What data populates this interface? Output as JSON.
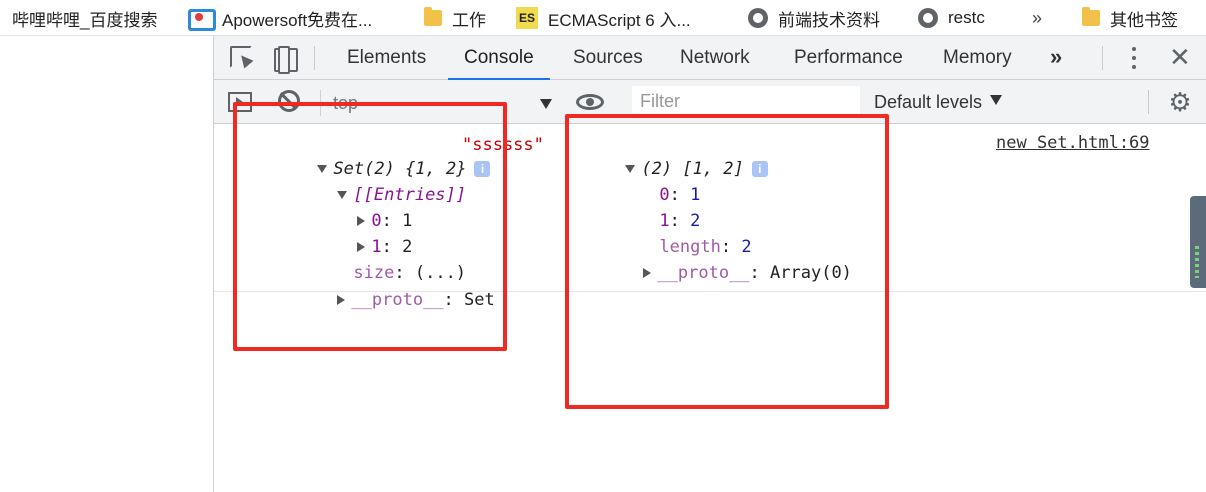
{
  "bookmarks": {
    "items": [
      {
        "label": "哔哩哔哩_百度搜索",
        "icon": "none"
      },
      {
        "label": "Apowersoft免费在...",
        "icon": "apowersoft-icon"
      },
      {
        "label": "工作",
        "icon": "folder-icon"
      },
      {
        "label": "ECMAScript 6 入...",
        "icon": "es-icon"
      },
      {
        "label": "前端技术资料",
        "icon": "globe-icon"
      },
      {
        "label": "restc",
        "icon": "globe-icon"
      },
      {
        "label": "»",
        "icon": "none"
      },
      {
        "label": "其他书签",
        "icon": "folder-icon"
      }
    ]
  },
  "devtools": {
    "tabs": [
      {
        "label": "Elements",
        "active": false
      },
      {
        "label": "Console",
        "active": true
      },
      {
        "label": "Sources",
        "active": false
      },
      {
        "label": "Network",
        "active": false
      },
      {
        "label": "Performance",
        "active": false
      },
      {
        "label": "Memory",
        "active": false
      }
    ],
    "more_tabs": "»",
    "close": "✕",
    "console_toolbar": {
      "context": "top",
      "filter_placeholder": "Filter",
      "levels": "Default levels"
    },
    "console": {
      "source_link": "new Set.html:69",
      "set_header": "Set(2) {1, 2}",
      "string_value": "\"ssssss\"",
      "array_header": "(2) [1, 2]",
      "entries_label": "[[Entries]]",
      "set_entries": [
        {
          "key": "0",
          "value": "1"
        },
        {
          "key": "1",
          "value": "2"
        }
      ],
      "size_key": "size",
      "size_value": "(...)",
      "set_proto_key": "__proto__",
      "set_proto_value": "Set",
      "array_items": [
        {
          "key": "0",
          "value": "1"
        },
        {
          "key": "1",
          "value": "2"
        }
      ],
      "length_key": "length",
      "length_value": "2",
      "array_proto_key": "__proto__",
      "array_proto_value": "Array(0)",
      "prompt": "›"
    }
  },
  "colors": {
    "annotation": "#f02a23",
    "accent": "#1a73e8",
    "object_key": "#881391",
    "number": "#1a1aa6",
    "string": "#c80000"
  }
}
